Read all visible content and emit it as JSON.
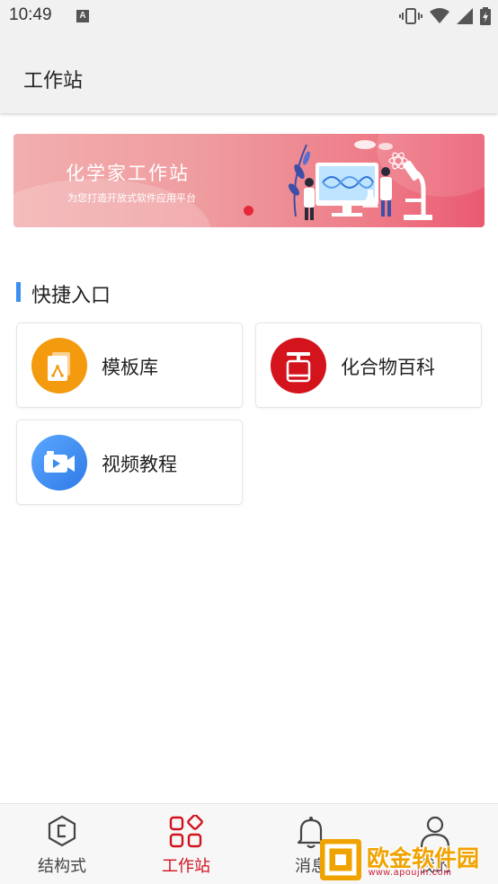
{
  "status_bar": {
    "time": "10:49",
    "icons": [
      "text-a-icon",
      "vibrate-icon",
      "wifi-icon",
      "cellular-signal-icon",
      "battery-charging-icon"
    ]
  },
  "app_bar": {
    "title": "工作站"
  },
  "banner": {
    "title": "化学家工作站",
    "subtitle": "为您打造开放式软件应用平台",
    "indicator_color": "#e6283a"
  },
  "quick_entry": {
    "title": "快捷入口",
    "accent_color": "#3c8ef3",
    "items": [
      {
        "label": "模板库",
        "icon": "template-library-icon",
        "color": "#f39a0e"
      },
      {
        "label": "化合物百科",
        "icon": "compound-encyclopedia-icon",
        "color": "#d4141c"
      },
      {
        "label": "视频教程",
        "icon": "video-tutorial-icon",
        "color": "#3a8bef"
      }
    ]
  },
  "bottom_nav": {
    "items": [
      {
        "label": "结构式",
        "icon": "structure-formula-icon"
      },
      {
        "label": "工作站",
        "icon": "workstation-grid-icon",
        "active": true
      },
      {
        "label": "消息",
        "icon": "bell-icon"
      },
      {
        "label": "我的",
        "icon": "user-icon"
      }
    ],
    "active_color": "#d0121d"
  },
  "watermark": {
    "text": "欧金软件园",
    "url": "www.apoujin.com"
  }
}
